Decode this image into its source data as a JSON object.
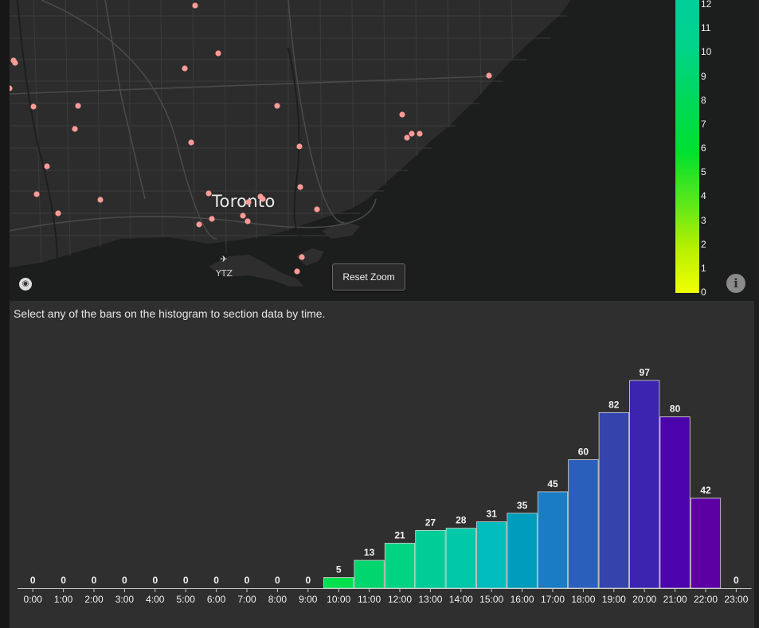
{
  "map": {
    "city_label": "Toronto",
    "airport_label": "YTZ",
    "airport_icon": "airplane-icon",
    "logo_icon": "mapbox-logo-icon",
    "reset_zoom_label": "Reset Zoom",
    "info_icon": "info-icon",
    "info_glyph": "i",
    "point_color": "#ff9a96",
    "legend": {
      "min": 0,
      "max": 12,
      "ticks": [
        "0",
        "1",
        "2",
        "3",
        "4",
        "5",
        "6",
        "7",
        "8",
        "9",
        "10",
        "11",
        "12"
      ],
      "color_low": "#f0ff00",
      "color_mid": "#00e030",
      "color_high": "#00ce9c"
    }
  },
  "histogram": {
    "instruction": "Select any of the bars on the histogram to section data by time."
  },
  "chart_data": {
    "type": "bar",
    "title": "",
    "xlabel": "",
    "ylabel": "",
    "categories": [
      "0:00",
      "1:00",
      "2:00",
      "3:00",
      "4:00",
      "5:00",
      "6:00",
      "7:00",
      "8:00",
      "9:00",
      "10:00",
      "11:00",
      "12:00",
      "13:00",
      "14:00",
      "15:00",
      "16:00",
      "17:00",
      "18:00",
      "19:00",
      "20:00",
      "21:00",
      "22:00",
      "23:00"
    ],
    "values": [
      0,
      0,
      0,
      0,
      0,
      0,
      0,
      0,
      0,
      0,
      5,
      13,
      21,
      27,
      28,
      31,
      35,
      45,
      60,
      82,
      97,
      80,
      42,
      0
    ],
    "colors": [
      "#00e040",
      "#00e040",
      "#00e040",
      "#00e040",
      "#00e040",
      "#00e040",
      "#00e040",
      "#00e040",
      "#00e040",
      "#00e040",
      "#00e04c",
      "#00d66e",
      "#00d482",
      "#00cc98",
      "#00c8a8",
      "#00bcbc",
      "#009cbc",
      "#1a7cc4",
      "#2a60bc",
      "#3444ac",
      "#3c24b0",
      "#4c04ac",
      "#5c00a4",
      "#5c00a4"
    ],
    "ylim": [
      0,
      97
    ],
    "grid": false,
    "data_labels": true
  }
}
